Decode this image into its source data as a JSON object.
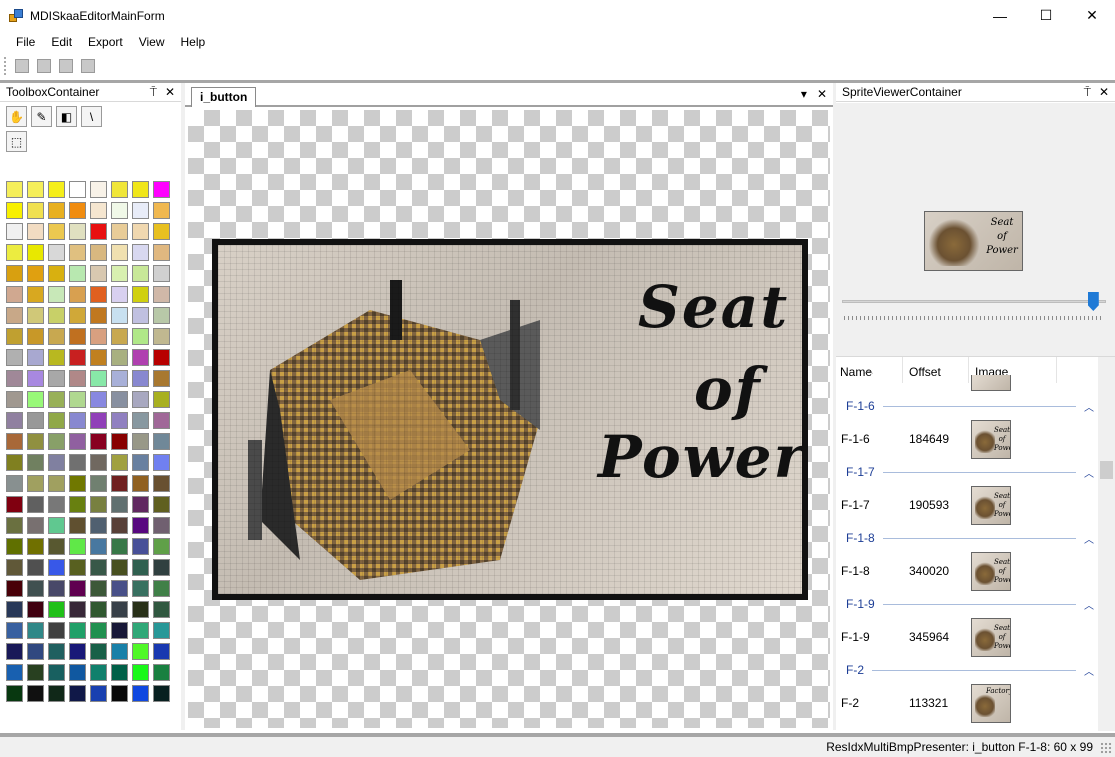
{
  "window": {
    "title": "MDISkaaEditorMainForm",
    "minimize": "—",
    "maximize": "☐",
    "close": "✕"
  },
  "menu": {
    "file": "File",
    "edit": "Edit",
    "export": "Export",
    "view": "View",
    "help": "Help"
  },
  "toolbox": {
    "title": "ToolboxContainer",
    "pin": "⍑",
    "close": "✕",
    "tools": [
      {
        "name": "hand-tool",
        "glyph": "✋"
      },
      {
        "name": "pencil-tool",
        "glyph": "✎"
      },
      {
        "name": "fill-tool",
        "glyph": "◧"
      },
      {
        "name": "line-tool",
        "glyph": "\\"
      },
      {
        "name": "select-tool",
        "glyph": "⬚"
      }
    ],
    "palette": [
      "#f5ee5a",
      "#f5ee5a",
      "#f5ee1a",
      "#ffffff",
      "#f8f2e8",
      "#f0e63a",
      "#f0e61a",
      "#ff00ff",
      "#f8f000",
      "#f0e050",
      "#e8b020",
      "#f08c10",
      "#f5e6d0",
      "#f0f8e8",
      "#e8ecf8",
      "#f0b850",
      "#f0f0f0",
      "#f2dcc2",
      "#ecc850",
      "#e0e0c0",
      "#e81010",
      "#e8cc98",
      "#f0d8b0",
      "#e8c020",
      "#ecec40",
      "#e8e800",
      "#d8d8d8",
      "#e0c080",
      "#d8b880",
      "#f0e0b0",
      "#d8d8f0",
      "#e0b880",
      "#d8a010",
      "#e0a010",
      "#d8b010",
      "#b8e8b0",
      "#d8c8b0",
      "#d8f0b0",
      "#c8e898",
      "#d0d0d0",
      "#d0a890",
      "#d8a820",
      "#c8e8b8",
      "#d8a050",
      "#e06020",
      "#d8d0f0",
      "#d0d010",
      "#d0b8a8",
      "#c8a888",
      "#d0c878",
      "#c8d068",
      "#d0a838",
      "#c07820",
      "#c8e0f0",
      "#c0c0e0",
      "#b8c8a8",
      "#c0a030",
      "#c89828",
      "#c8a850",
      "#c07020",
      "#d8a080",
      "#c8a850",
      "#b0e888",
      "#c0b890",
      "#b0b0b0",
      "#a8a8d0",
      "#b8b820",
      "#c82020",
      "#c08020",
      "#a8b080",
      "#b040b0",
      "#b80000",
      "#a08898",
      "#a888e0",
      "#a8a8a8",
      "#b08888",
      "#88e8a8",
      "#a8b0d8",
      "#8888d0",
      "#a87830",
      "#a09890",
      "#98f878",
      "#98b058",
      "#b0d890",
      "#8888e0",
      "#8890a0",
      "#a8a8c0",
      "#a8b020",
      "#9080a0",
      "#989898",
      "#90a848",
      "#8888d0",
      "#9040b8",
      "#9080c0",
      "#8898a0",
      "#a06898",
      "#a86838",
      "#909040",
      "#88a068",
      "#9060a0",
      "#880020",
      "#880000",
      "#989888",
      "#708898",
      "#808020",
      "#708060",
      "#8080a0",
      "#707070",
      "#706860",
      "#a0a040",
      "#6880a0",
      "#7080f0",
      "#889090",
      "#a0a060",
      "#a0a060",
      "#707800",
      "#708070",
      "#702020",
      "#906020",
      "#685030",
      "#800010",
      "#606060",
      "#787878",
      "#688010",
      "#788040",
      "#607070",
      "#602860",
      "#606020",
      "#6a7040",
      "#787070",
      "#60c890",
      "#605030",
      "#506070",
      "#584038",
      "#580880",
      "#706070",
      "#607000",
      "#707000",
      "#585830",
      "#60e848",
      "#4878a0",
      "#387848",
      "#485098",
      "#60a048",
      "#605838",
      "#505050",
      "#3858e8",
      "#586020",
      "#385848",
      "#485020",
      "#306050",
      "#304040",
      "#480008",
      "#405050",
      "#484868",
      "#600050",
      "#3c5838",
      "#485088",
      "#387060",
      "#408048",
      "#283858",
      "#400010",
      "#20c018",
      "#382838",
      "#305830",
      "#384048",
      "#283018",
      "#305840",
      "#3860a0",
      "#308888",
      "#404040",
      "#20a068",
      "#209050",
      "#181838",
      "#30a878",
      "#289898",
      "#181858",
      "#304880",
      "#206060",
      "#181878",
      "#186048",
      "#1880a8",
      "#50f828",
      "#1838b0",
      "#1860b0",
      "#284020",
      "#186060",
      "#1058a0",
      "#10806c",
      "#006048",
      "#18f818",
      "#188040",
      "#083810",
      "#101010",
      "#102818",
      "#101848",
      "#1840b0",
      "#080808",
      "#1048e0",
      "#082020"
    ]
  },
  "document": {
    "tab": "i_button",
    "dropdown": "▾",
    "close": "✕",
    "sprite_text": [
      "Seat",
      "of",
      "Power"
    ]
  },
  "viewer": {
    "title": "SpriteViewerContainer",
    "pin": "⍑",
    "close": "✕",
    "thumb_text": [
      "Seat",
      "of",
      "Power"
    ],
    "slider_fraction": 0.95,
    "columns": {
      "name": "Name",
      "offset": "Offset",
      "image": "Image"
    },
    "rows": [
      {
        "group": "F-1-6",
        "name": "F-1-6",
        "offset": "184649",
        "caption": "Seat of Power"
      },
      {
        "group": "F-1-7",
        "name": "F-1-7",
        "offset": "190593",
        "caption": "Seat of Power"
      },
      {
        "group": "F-1-8",
        "name": "F-1-8",
        "offset": "340020",
        "caption": "Seat of Power"
      },
      {
        "group": "F-1-9",
        "name": "F-1-9",
        "offset": "345964",
        "caption": "Seat of Power"
      },
      {
        "group": "F-2",
        "name": "F-2",
        "offset": "113321",
        "caption": "Factory"
      }
    ]
  },
  "status": {
    "text": "ResIdxMultiBmpPresenter: i_button   F-1-8: 60 x 99"
  }
}
